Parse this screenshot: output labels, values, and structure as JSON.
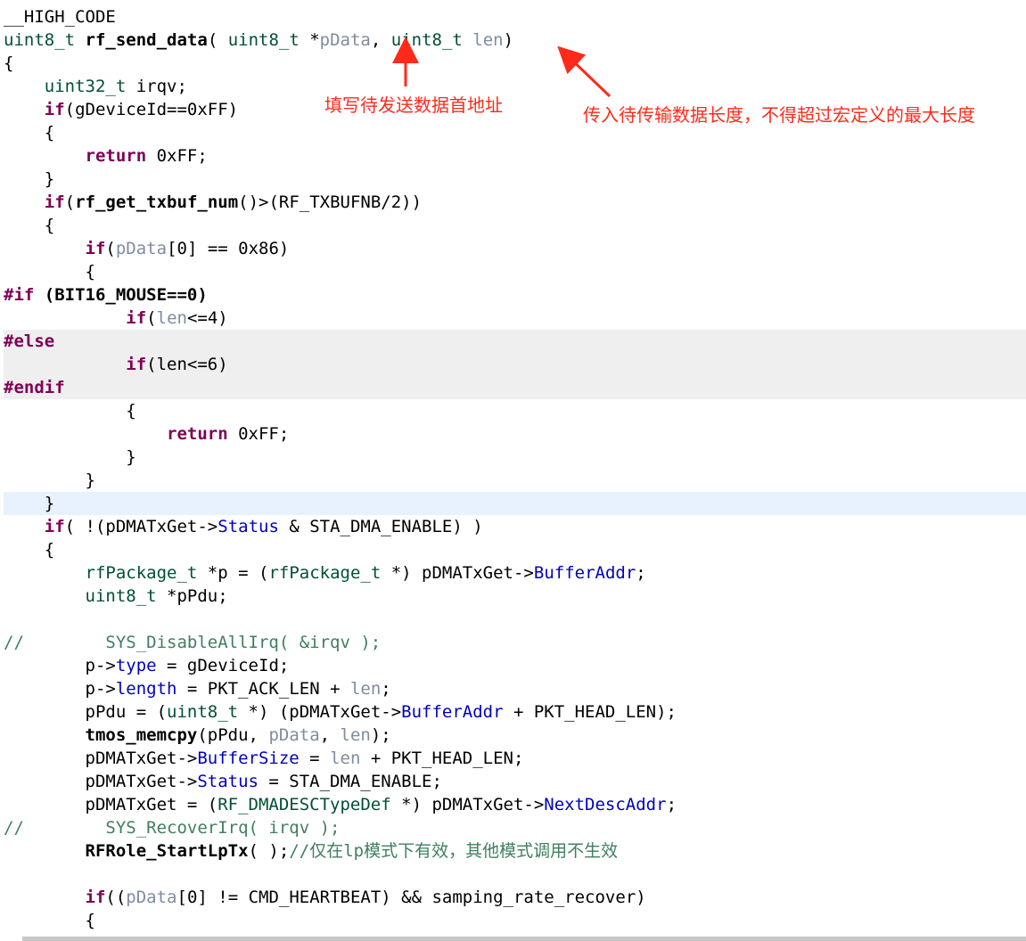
{
  "editor": {
    "line_height": 26,
    "lines": [
      {
        "tokens": [
          {
            "t": "__HIGH_CODE",
            "c": "plain"
          }
        ]
      },
      {
        "tokens": [
          {
            "t": "uint8_t",
            "c": "type"
          },
          {
            "t": " ",
            "c": "plain"
          },
          {
            "t": "rf_send_data",
            "c": "fn"
          },
          {
            "t": "( ",
            "c": "plain"
          },
          {
            "t": "uint8_t",
            "c": "type"
          },
          {
            "t": " *",
            "c": "plain"
          },
          {
            "t": "pData",
            "c": "param"
          },
          {
            "t": ", ",
            "c": "plain"
          },
          {
            "t": "uint8_t",
            "c": "type"
          },
          {
            "t": " ",
            "c": "plain"
          },
          {
            "t": "len",
            "c": "param"
          },
          {
            "t": ")",
            "c": "plain"
          }
        ]
      },
      {
        "tokens": [
          {
            "t": "{",
            "c": "plain"
          }
        ]
      },
      {
        "tokens": [
          {
            "t": "    ",
            "c": "plain"
          },
          {
            "t": "uint32_t",
            "c": "type"
          },
          {
            "t": " irqv;",
            "c": "plain"
          }
        ]
      },
      {
        "tokens": [
          {
            "t": "    ",
            "c": "plain"
          },
          {
            "t": "if",
            "c": "kw"
          },
          {
            "t": "(gDeviceId==0xFF)",
            "c": "plain"
          }
        ]
      },
      {
        "tokens": [
          {
            "t": "    {",
            "c": "plain"
          }
        ]
      },
      {
        "tokens": [
          {
            "t": "        ",
            "c": "plain"
          },
          {
            "t": "return",
            "c": "kw"
          },
          {
            "t": " 0xFF;",
            "c": "plain"
          }
        ]
      },
      {
        "tokens": [
          {
            "t": "    }",
            "c": "plain"
          }
        ]
      },
      {
        "tokens": [
          {
            "t": "    ",
            "c": "plain"
          },
          {
            "t": "if",
            "c": "kw"
          },
          {
            "t": "(",
            "c": "plain"
          },
          {
            "t": "rf_get_txbuf_num",
            "c": "fn"
          },
          {
            "t": "()>(",
            "c": "plain"
          },
          {
            "t": "RF_TXBUFNB",
            "c": "macro"
          },
          {
            "t": "/2))",
            "c": "plain"
          }
        ]
      },
      {
        "tokens": [
          {
            "t": "    {",
            "c": "plain"
          }
        ]
      },
      {
        "tokens": [
          {
            "t": "        ",
            "c": "plain"
          },
          {
            "t": "if",
            "c": "kw"
          },
          {
            "t": "(",
            "c": "plain"
          },
          {
            "t": "pData",
            "c": "param"
          },
          {
            "t": "[0] == 0x86)",
            "c": "plain"
          }
        ]
      },
      {
        "tokens": [
          {
            "t": "        {",
            "c": "plain"
          }
        ]
      },
      {
        "tokens": [
          {
            "t": "#if",
            "c": "pp"
          },
          {
            "t": " (BIT16_MOUSE==0)",
            "c": "fn"
          }
        ]
      },
      {
        "tokens": [
          {
            "t": "            ",
            "c": "plain"
          },
          {
            "t": "if",
            "c": "kw"
          },
          {
            "t": "(",
            "c": "plain"
          },
          {
            "t": "len",
            "c": "param"
          },
          {
            "t": "<=4)",
            "c": "plain"
          }
        ]
      },
      {
        "hl": "gray",
        "tokens": [
          {
            "t": "#else",
            "c": "pp"
          }
        ]
      },
      {
        "hl": "gray",
        "tokens": [
          {
            "t": "            ",
            "c": "plain"
          },
          {
            "t": "if",
            "c": "kw"
          },
          {
            "t": "(len<=6)",
            "c": "plain"
          }
        ]
      },
      {
        "hl": "gray",
        "tokens": [
          {
            "t": "#endif",
            "c": "pp"
          }
        ]
      },
      {
        "tokens": [
          {
            "t": "            {",
            "c": "plain"
          }
        ]
      },
      {
        "tokens": [
          {
            "t": "                ",
            "c": "plain"
          },
          {
            "t": "return",
            "c": "kw"
          },
          {
            "t": " 0xFF;",
            "c": "plain"
          }
        ]
      },
      {
        "tokens": [
          {
            "t": "            }",
            "c": "plain"
          }
        ]
      },
      {
        "tokens": [
          {
            "t": "        }",
            "c": "plain"
          }
        ]
      },
      {
        "hl": "blue",
        "tokens": [
          {
            "t": "    }",
            "c": "plain"
          }
        ]
      },
      {
        "tokens": [
          {
            "t": "    ",
            "c": "plain"
          },
          {
            "t": "if",
            "c": "kw"
          },
          {
            "t": "( !(pDMATxGet->",
            "c": "plain"
          },
          {
            "t": "Status",
            "c": "field"
          },
          {
            "t": " & STA_DMA_ENABLE) )",
            "c": "plain"
          }
        ]
      },
      {
        "tokens": [
          {
            "t": "    {",
            "c": "plain"
          }
        ]
      },
      {
        "tokens": [
          {
            "t": "        ",
            "c": "plain"
          },
          {
            "t": "rfPackage_t",
            "c": "type"
          },
          {
            "t": " *p = (",
            "c": "plain"
          },
          {
            "t": "rfPackage_t",
            "c": "type"
          },
          {
            "t": " *) pDMATxGet->",
            "c": "plain"
          },
          {
            "t": "BufferAddr",
            "c": "field"
          },
          {
            "t": ";",
            "c": "plain"
          }
        ]
      },
      {
        "tokens": [
          {
            "t": "        ",
            "c": "plain"
          },
          {
            "t": "uint8_t",
            "c": "type"
          },
          {
            "t": " *pPdu;",
            "c": "plain"
          }
        ]
      },
      {
        "tokens": [
          {
            "t": "",
            "c": "plain"
          }
        ]
      },
      {
        "tokens": [
          {
            "t": "//        SYS_DisableAllIrq( &irqv );",
            "c": "cmt"
          }
        ]
      },
      {
        "tokens": [
          {
            "t": "        p->",
            "c": "plain"
          },
          {
            "t": "type",
            "c": "field"
          },
          {
            "t": " = gDeviceId;",
            "c": "plain"
          }
        ]
      },
      {
        "tokens": [
          {
            "t": "        p->",
            "c": "plain"
          },
          {
            "t": "length",
            "c": "field"
          },
          {
            "t": " = PKT_ACK_LEN + ",
            "c": "plain"
          },
          {
            "t": "len",
            "c": "param"
          },
          {
            "t": ";",
            "c": "plain"
          }
        ]
      },
      {
        "tokens": [
          {
            "t": "        pPdu = (",
            "c": "plain"
          },
          {
            "t": "uint8_t",
            "c": "type"
          },
          {
            "t": " *) (pDMATxGet->",
            "c": "plain"
          },
          {
            "t": "BufferAddr",
            "c": "field"
          },
          {
            "t": " + PKT_HEAD_LEN);",
            "c": "plain"
          }
        ]
      },
      {
        "tokens": [
          {
            "t": "        ",
            "c": "plain"
          },
          {
            "t": "tmos_memcpy",
            "c": "fn"
          },
          {
            "t": "(pPdu, ",
            "c": "plain"
          },
          {
            "t": "pData",
            "c": "param"
          },
          {
            "t": ", ",
            "c": "plain"
          },
          {
            "t": "len",
            "c": "param"
          },
          {
            "t": ");",
            "c": "plain"
          }
        ]
      },
      {
        "tokens": [
          {
            "t": "        pDMATxGet->",
            "c": "plain"
          },
          {
            "t": "BufferSize",
            "c": "field"
          },
          {
            "t": " = ",
            "c": "plain"
          },
          {
            "t": "len",
            "c": "param"
          },
          {
            "t": " + PKT_HEAD_LEN;",
            "c": "plain"
          }
        ]
      },
      {
        "tokens": [
          {
            "t": "        pDMATxGet->",
            "c": "plain"
          },
          {
            "t": "Status",
            "c": "field"
          },
          {
            "t": " = STA_DMA_ENABLE;",
            "c": "plain"
          }
        ]
      },
      {
        "tokens": [
          {
            "t": "        pDMATxGet = (",
            "c": "plain"
          },
          {
            "t": "RF_DMADESCTypeDef",
            "c": "type"
          },
          {
            "t": " *) pDMATxGet->",
            "c": "plain"
          },
          {
            "t": "NextDescAddr",
            "c": "field"
          },
          {
            "t": ";",
            "c": "plain"
          }
        ]
      },
      {
        "tokens": [
          {
            "t": "//        SYS_RecoverIrq( irqv );",
            "c": "cmt"
          }
        ]
      },
      {
        "tokens": [
          {
            "t": "        ",
            "c": "plain"
          },
          {
            "t": "RFRole_StartLpTx",
            "c": "fn"
          },
          {
            "t": "( );",
            "c": "plain"
          },
          {
            "t": "//仅在lp模式下有效，其他模式调用不生效",
            "c": "cmt"
          }
        ]
      },
      {
        "tokens": [
          {
            "t": "",
            "c": "plain"
          }
        ]
      },
      {
        "tokens": [
          {
            "t": "        ",
            "c": "plain"
          },
          {
            "t": "if",
            "c": "kw"
          },
          {
            "t": "((",
            "c": "plain"
          },
          {
            "t": "pData",
            "c": "param"
          },
          {
            "t": "[0] != CMD_HEARTBEAT) && samping_rate_recover)",
            "c": "plain"
          }
        ]
      },
      {
        "tokens": [
          {
            "t": "        {",
            "c": "plain"
          }
        ]
      }
    ]
  },
  "annotations": {
    "pdata_note": "填写待发送数据首地址",
    "len_note": "传入待传输数据长度，不得超过宏定义的最大长度",
    "color": "#ff2a1a"
  }
}
